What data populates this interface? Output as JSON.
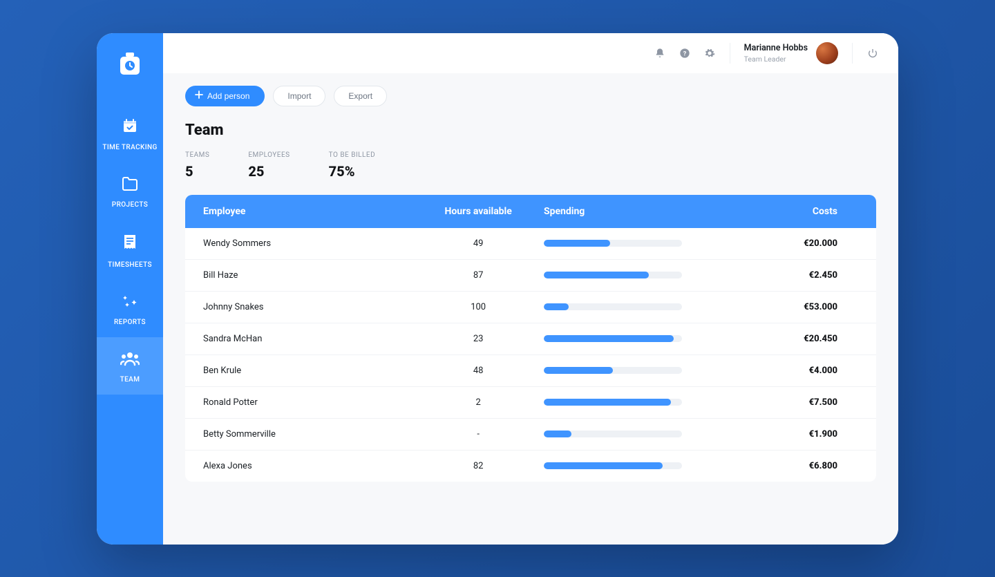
{
  "sidebar": {
    "items": [
      {
        "label": "TIME TRACKING"
      },
      {
        "label": "PROJECTS"
      },
      {
        "label": "TIMESHEETS"
      },
      {
        "label": "REPORTS"
      },
      {
        "label": "TEAM"
      }
    ]
  },
  "topbar": {
    "user_name": "Marianne Hobbs",
    "user_role": "Team Leader"
  },
  "actions": {
    "add_person": "Add person",
    "import": "Import",
    "export": "Export"
  },
  "page": {
    "title": "Team"
  },
  "kpis": {
    "teams_label": "TEAMS",
    "teams_value": "5",
    "employees_label": "EMPLOYEES",
    "employees_value": "25",
    "billed_label": "TO BE BILLED",
    "billed_value": "75%"
  },
  "table": {
    "head": {
      "employee": "Employee",
      "hours": "Hours available",
      "spending": "Spending",
      "costs": "Costs"
    },
    "rows": [
      {
        "name": "Wendy Sommers",
        "hours": "49",
        "spending_pct": 48,
        "cost": "€20.000"
      },
      {
        "name": "Bill Haze",
        "hours": "87",
        "spending_pct": 76,
        "cost": "€2.450"
      },
      {
        "name": "Johnny Snakes",
        "hours": "100",
        "spending_pct": 18,
        "cost": "€53.000"
      },
      {
        "name": "Sandra McHan",
        "hours": "23",
        "spending_pct": 94,
        "cost": "€20.450"
      },
      {
        "name": "Ben Krule",
        "hours": "48",
        "spending_pct": 50,
        "cost": "€4.000"
      },
      {
        "name": "Ronald Potter",
        "hours": "2",
        "spending_pct": 92,
        "cost": "€7.500"
      },
      {
        "name": "Betty Sommerville",
        "hours": "-",
        "spending_pct": 20,
        "cost": "€1.900"
      },
      {
        "name": "Alexa Jones",
        "hours": "82",
        "spending_pct": 86,
        "cost": "€6.800"
      }
    ]
  }
}
